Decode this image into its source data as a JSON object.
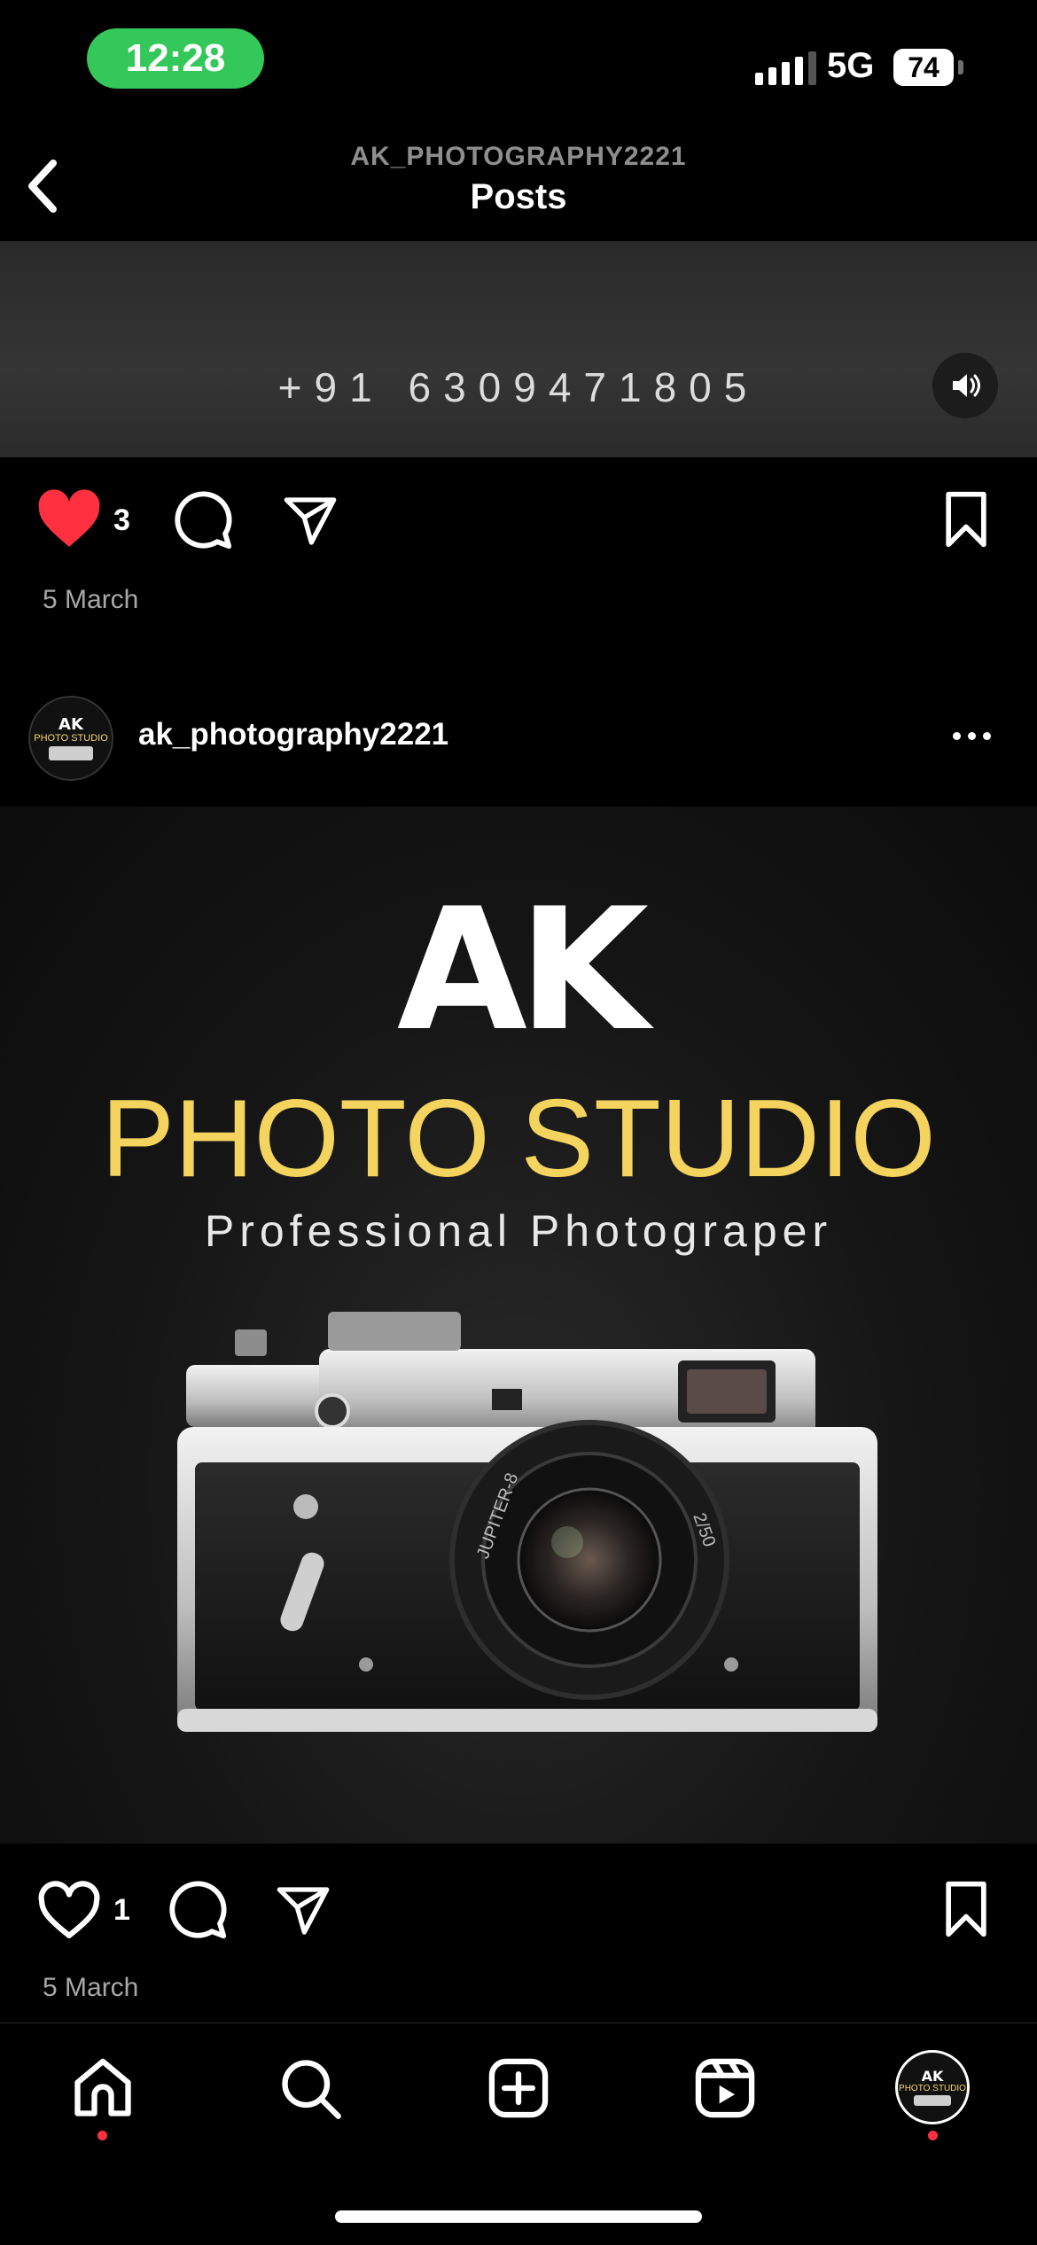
{
  "status_bar": {
    "time": "12:28",
    "network": "5G",
    "battery": "74"
  },
  "header": {
    "username": "AK_PHOTOGRAPHY2221",
    "title": "Posts"
  },
  "previous_post": {
    "media_text": "+91 6309471805",
    "likes": "3",
    "date": "5 March",
    "liked": true
  },
  "post": {
    "username": "ak_photography2221",
    "avatar_text": {
      "logo": "AK",
      "sub": "PHOTO STUDIO"
    },
    "image": {
      "logo_text": "AK",
      "studio_text": "PHOTO STUDIO",
      "tagline": "Professional Photograper",
      "lens_text_left": "JUPITER-8",
      "lens_text_right": "2/50"
    },
    "likes": "1",
    "date": "5 March",
    "liked": false
  },
  "bottom_nav": {
    "items": [
      "home-icon",
      "search-icon",
      "create-icon",
      "reels-icon",
      "profile-avatar"
    ],
    "active": "home"
  },
  "colors": {
    "like_red": "#ff3040",
    "status_green": "#34c759",
    "brand_yellow": "#f4d35e"
  }
}
